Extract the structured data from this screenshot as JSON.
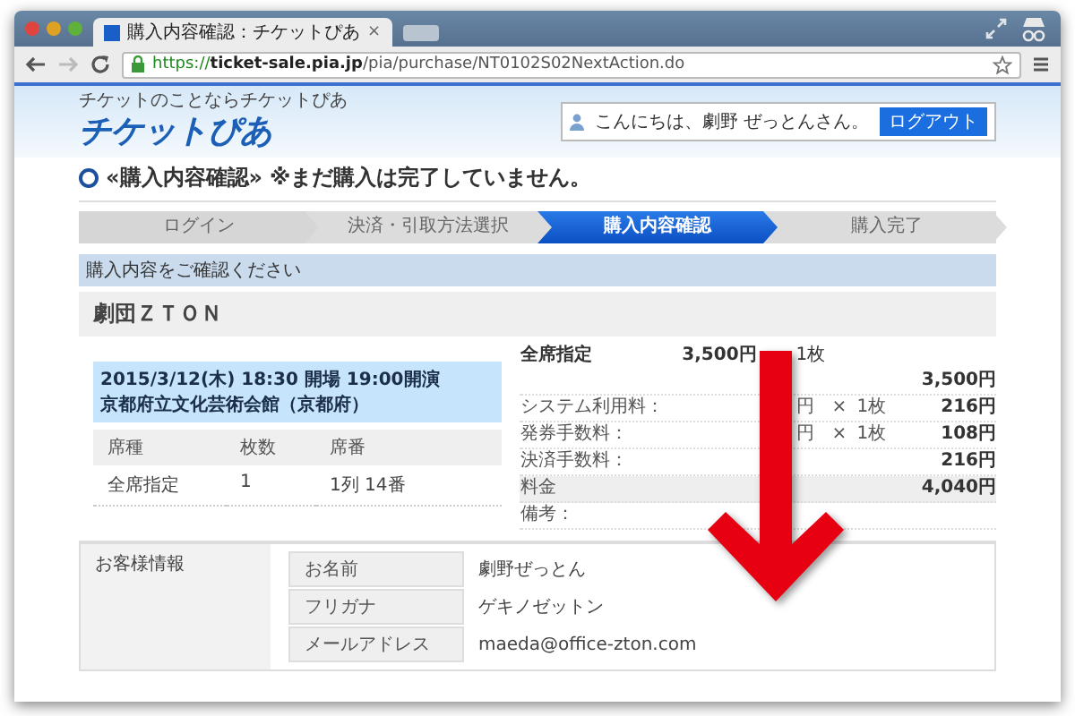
{
  "browser": {
    "tab_title": "購入内容確認：チケットぴあ",
    "tab_close": "×",
    "url_scheme": "https://",
    "url_host": "ticket-sale.pia.jp",
    "url_path": "/pia/purchase/NT0102S02NextAction.do"
  },
  "header": {
    "tagline": "チケットのことならチケットぴあ",
    "logo": "チケットぴあ",
    "greeting": "こんにちは、劇野 ぜっとんさん。",
    "logout": "ログアウト"
  },
  "page_heading": {
    "title": "«購入内容確認»",
    "note": "※まだ購入は完了していません。"
  },
  "steps": [
    {
      "label": "ログイン",
      "selected": false
    },
    {
      "label": "決済・引取方法選択",
      "selected": false
    },
    {
      "label": "購入内容確認",
      "selected": true
    },
    {
      "label": "購入完了",
      "selected": false
    }
  ],
  "notice": "購入内容をご確認ください",
  "performance_title": "劇団ＺＴＯＮ",
  "event": {
    "datetime": "2015/3/12(木) 18:30 開場  19:00開演",
    "venue": "京都府立文化芸術会館（京都府）"
  },
  "seats": {
    "columns": [
      "席種",
      "枚数",
      "席番"
    ],
    "rows": [
      [
        "全席指定",
        "1",
        "1列 14番"
      ]
    ]
  },
  "fees": [
    {
      "kind": "ticket",
      "label": "全席指定",
      "price": "3,500円",
      "qty": "1枚",
      "amount": "3,500円"
    },
    {
      "kind": "fee",
      "label": "システム利用料：",
      "unit": "円",
      "times": "×",
      "qty": "1枚",
      "amount": "216円"
    },
    {
      "kind": "fee",
      "label": "発券手数料：",
      "unit": "円",
      "times": "×",
      "qty": "1枚",
      "amount": "108円"
    },
    {
      "kind": "fee",
      "label": "決済手数料：",
      "amount": "216円"
    },
    {
      "kind": "total",
      "label": "料金",
      "amount": "4,040円"
    },
    {
      "kind": "note",
      "label": "備考："
    }
  ],
  "customer": {
    "section_label": "お客様情報",
    "fields": [
      {
        "label": "お名前",
        "value": "劇野ぜっとん"
      },
      {
        "label": "フリガナ",
        "value": "ゲキノゼットン"
      },
      {
        "label": "メールアドレス",
        "value": "maeda@office-zton.com"
      }
    ]
  }
}
